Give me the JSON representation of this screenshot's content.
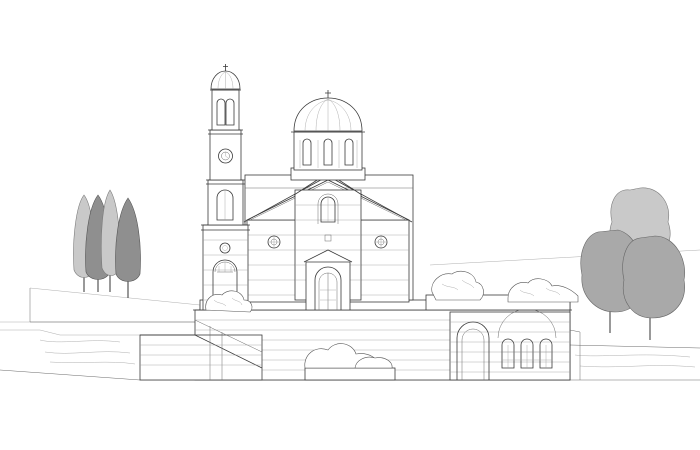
{
  "drawing": {
    "type": "architectural-elevation",
    "subject": "church-with-bell-tower-and-dome",
    "colors": {
      "line": "#3a3a3a",
      "tree_dark": "#8f8f8f",
      "tree_mid": "#a9a9a9",
      "tree_light": "#c9c9c9",
      "background": "#ffffff"
    }
  }
}
